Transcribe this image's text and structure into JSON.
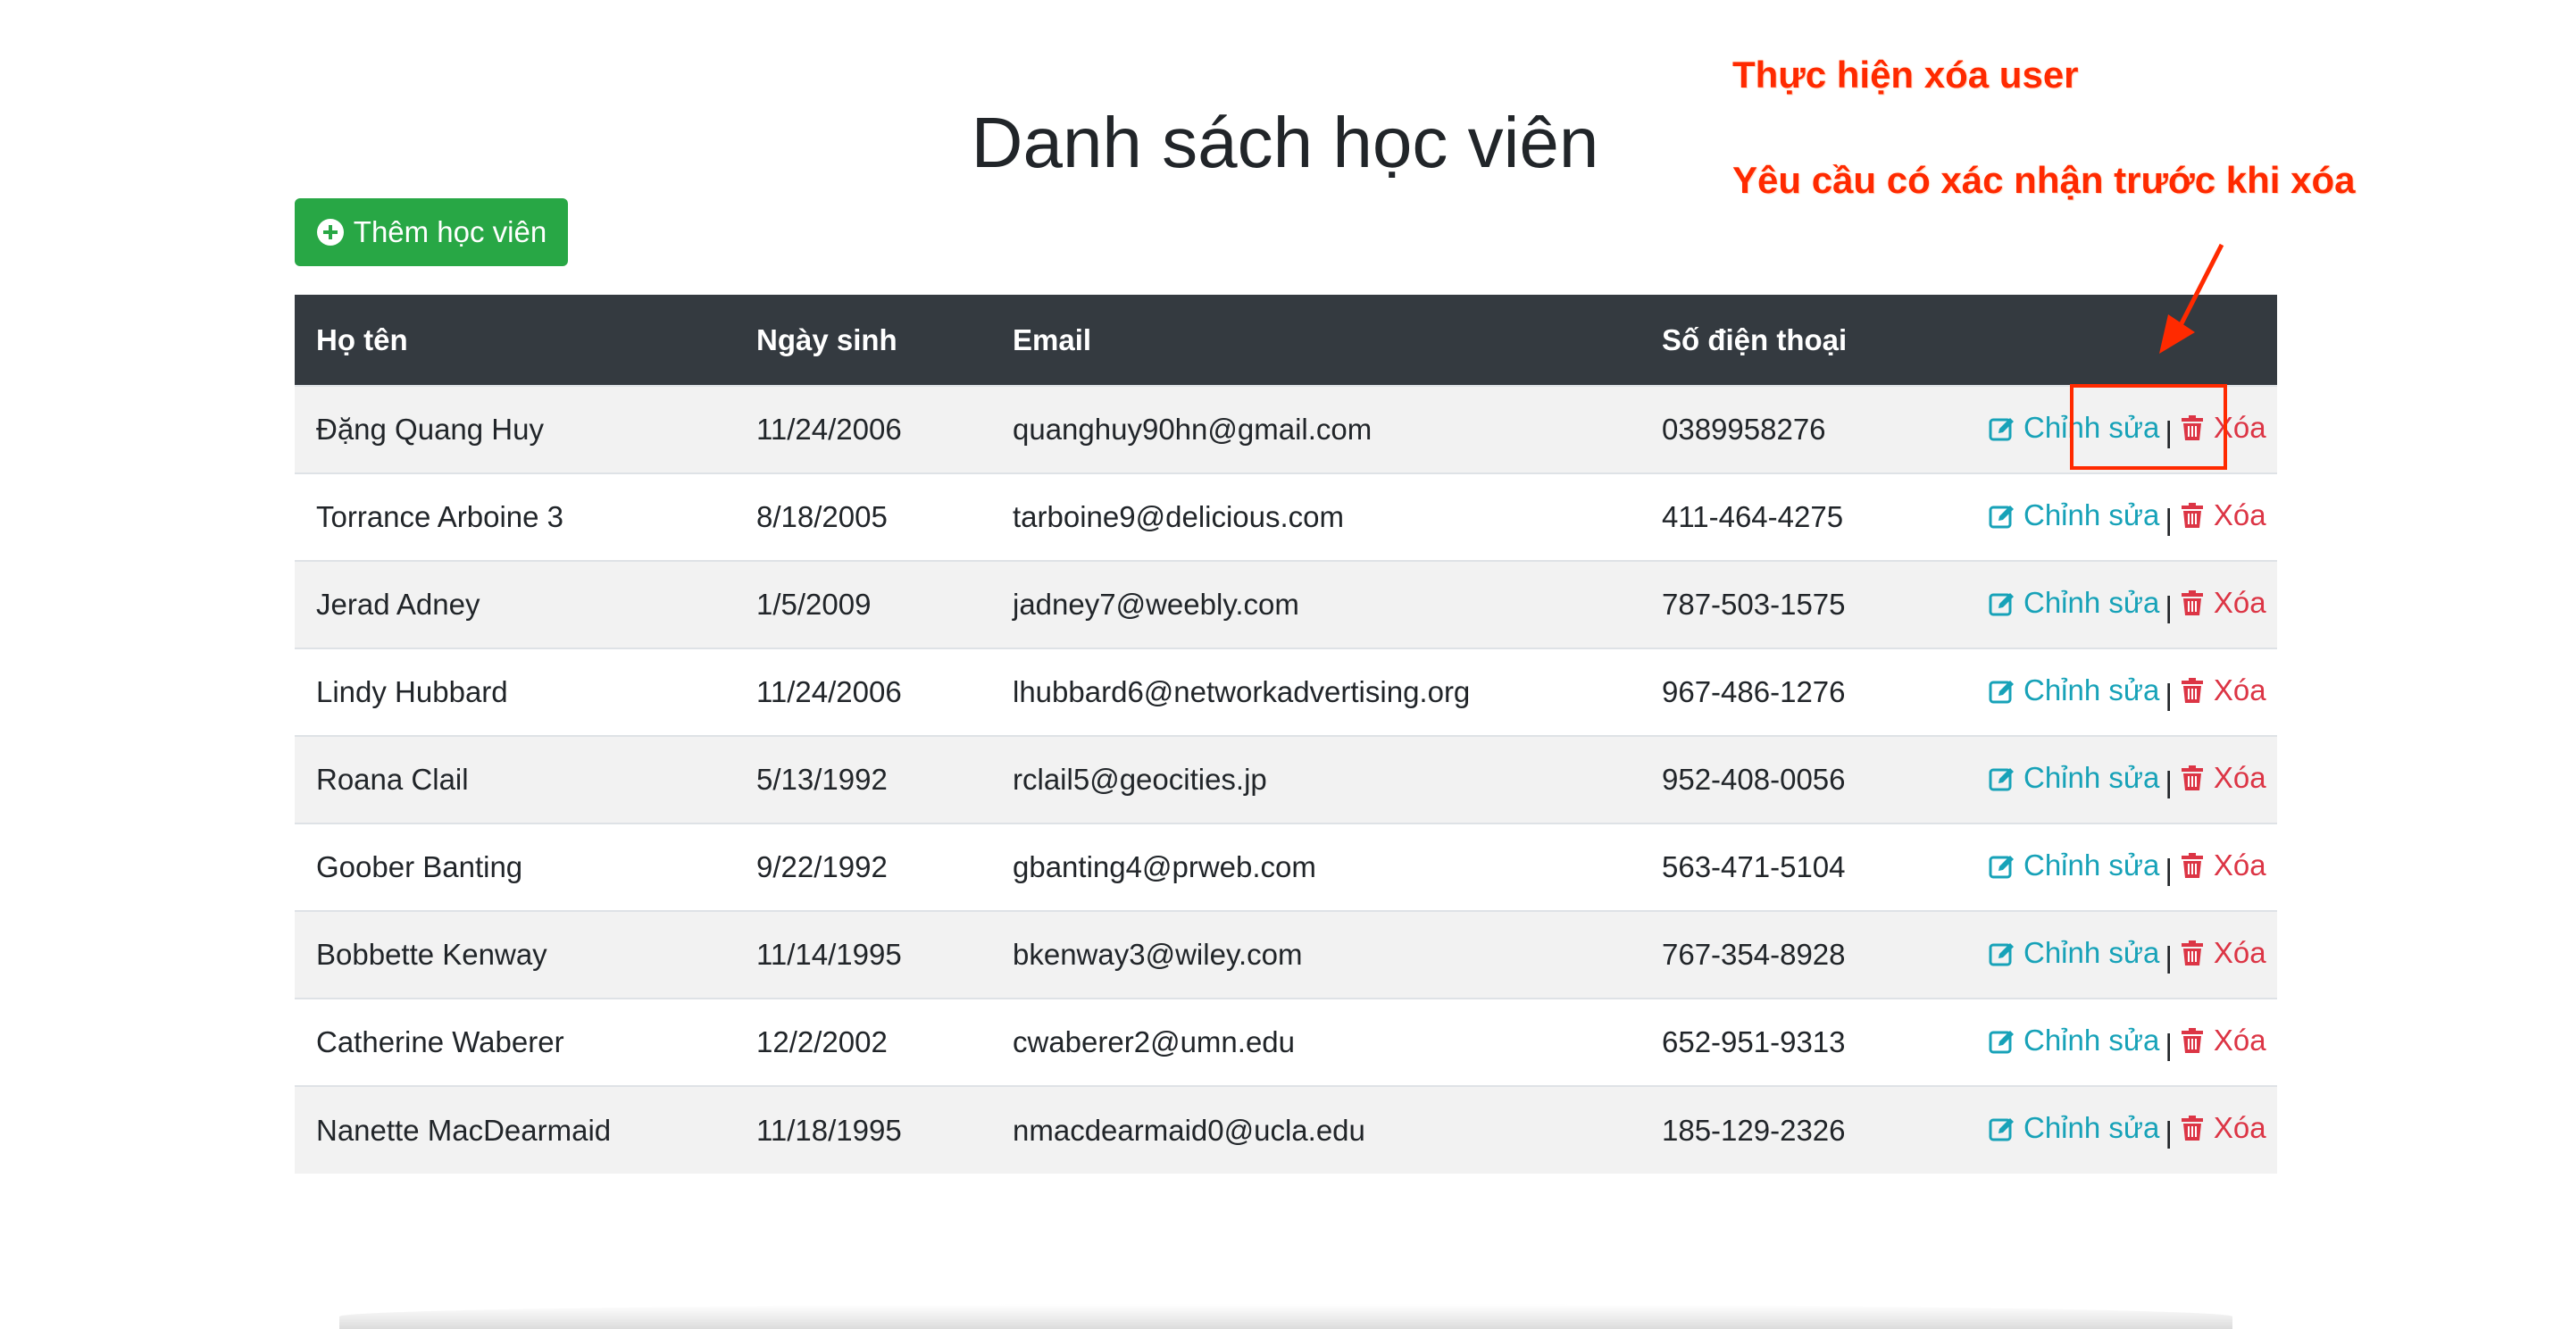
{
  "page": {
    "title": "Danh sách học viên",
    "add_button_label": "Thêm học viên"
  },
  "table": {
    "headers": [
      "Họ tên",
      "Ngày sinh",
      "Email",
      "Số điện thoại",
      ""
    ],
    "rows": [
      {
        "name": "Đặng Quang Huy",
        "dob": "11/24/2006",
        "email": "quanghuy90hn@gmail.com",
        "phone": "0389958276"
      },
      {
        "name": "Torrance Arboine 3",
        "dob": "8/18/2005",
        "email": "tarboine9@delicious.com",
        "phone": "411-464-4275"
      },
      {
        "name": "Jerad Adney",
        "dob": "1/5/2009",
        "email": "jadney7@weebly.com",
        "phone": "787-503-1575"
      },
      {
        "name": "Lindy Hubbard",
        "dob": "11/24/2006",
        "email": "lhubbard6@networkadvertising.org",
        "phone": "967-486-1276"
      },
      {
        "name": "Roana Clail",
        "dob": "5/13/1992",
        "email": "rclail5@geocities.jp",
        "phone": "952-408-0056"
      },
      {
        "name": "Goober Banting",
        "dob": "9/22/1992",
        "email": "gbanting4@prweb.com",
        "phone": "563-471-5104"
      },
      {
        "name": "Bobbette Kenway",
        "dob": "11/14/1995",
        "email": "bkenway3@wiley.com",
        "phone": "767-354-8928"
      },
      {
        "name": "Catherine Waberer",
        "dob": "12/2/2002",
        "email": "cwaberer2@umn.edu",
        "phone": "652-951-9313"
      },
      {
        "name": "Nanette MacDearmaid",
        "dob": "11/18/1995",
        "email": "nmacdearmaid0@ucla.edu",
        "phone": "185-129-2326"
      }
    ],
    "edit_label": "Chỉnh sửa",
    "separator": "|",
    "delete_label": "Xóa"
  },
  "annotations": {
    "line1": "Thực hiện xóa user",
    "line2": "Yêu cầu có xác nhận trước khi xóa"
  },
  "icons": {
    "add": "plus-circle-icon",
    "edit": "edit-icon",
    "delete": "trash-icon"
  },
  "colors": {
    "add_button": "#28a745",
    "table_header": "#343a40",
    "edit_link": "#17a2b8",
    "delete_link": "#dc3545",
    "annotation": "#ff2a00"
  }
}
